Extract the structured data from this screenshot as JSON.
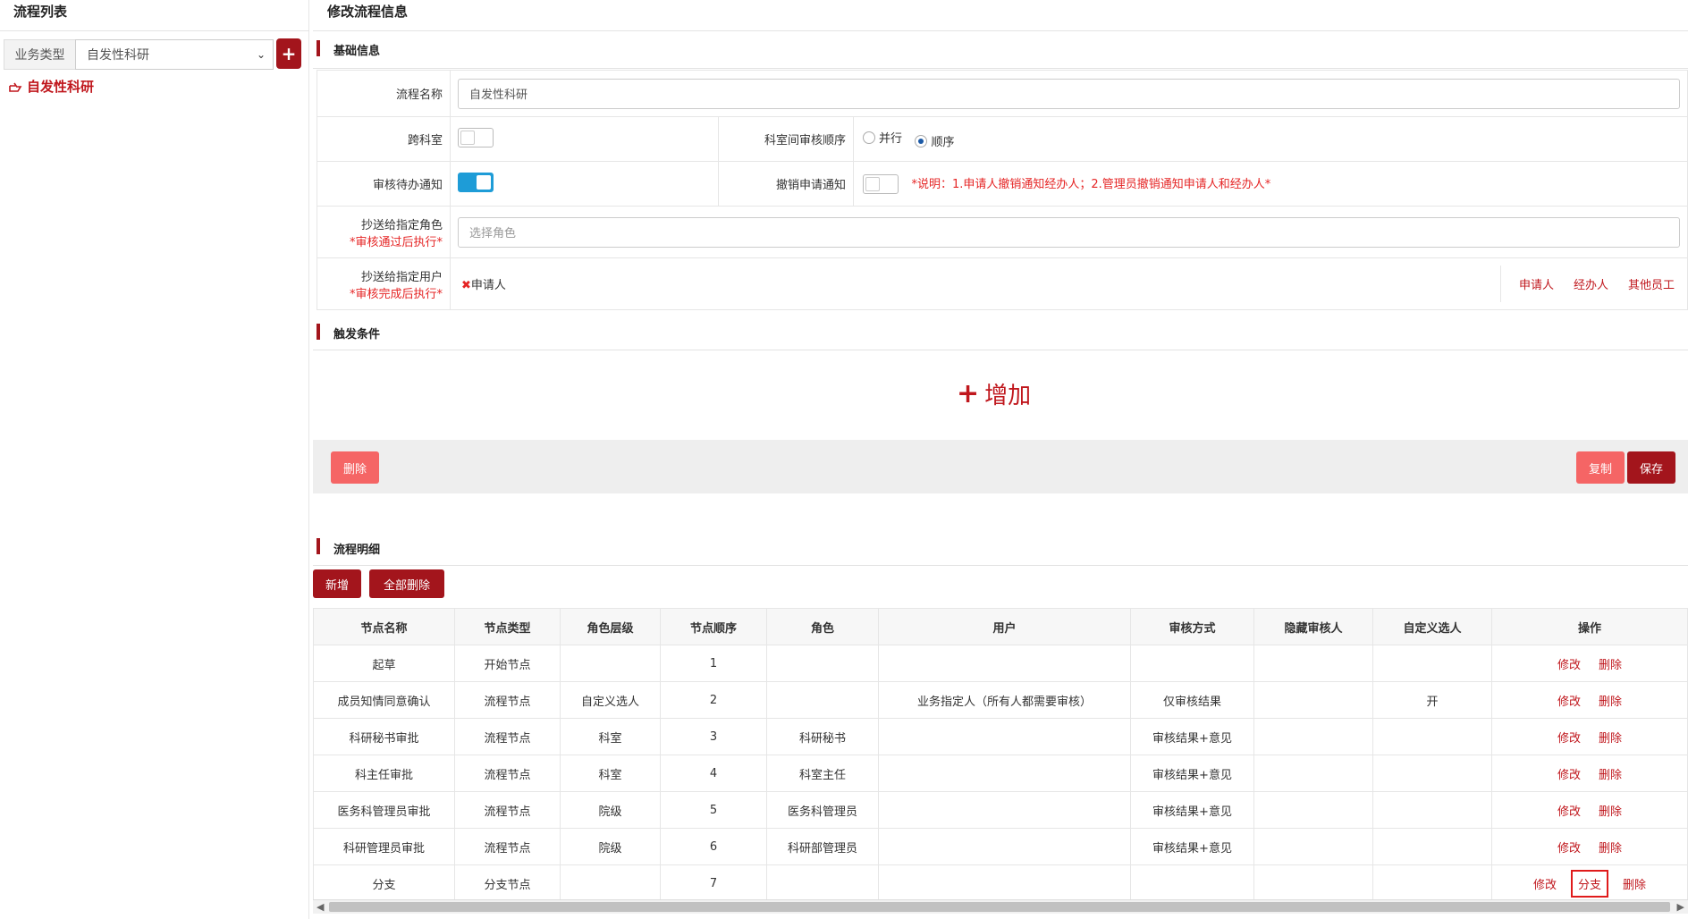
{
  "left": {
    "title": "流程列表",
    "type_label": "业务类型",
    "type_value": "自发性科研",
    "add_icon": "plus-icon",
    "tree_item": "自发性科研"
  },
  "right": {
    "title": "修改流程信息"
  },
  "basic": {
    "section_title": "基础信息",
    "name_label": "流程名称",
    "name_value": "自发性科研",
    "cross_label": "跨科室",
    "cross_on": false,
    "order_label": "科室间审核顺序",
    "order_options": [
      "并行",
      "顺序"
    ],
    "order_selected": "顺序",
    "notify_label": "审核待办通知",
    "notify_on": true,
    "revoke_label": "撤销申请通知",
    "revoke_on": false,
    "revoke_note": "*说明：1.申请人撤销通知经办人；2.管理员撤销通知申请人和经办人*",
    "role_label": "抄送给指定角色",
    "role_req": "*审核通过后执行*",
    "role_placeholder": "选择角色",
    "user_label": "抄送给指定用户",
    "user_req": "*审核完成后执行*",
    "user_tag": "申请人",
    "user_links": [
      "申请人",
      "经办人",
      "其他员工"
    ]
  },
  "trigger": {
    "section_title": "触发条件",
    "add_label": "增加"
  },
  "actions": {
    "delete": "删除",
    "copy": "复制",
    "save": "保存"
  },
  "detail": {
    "section_title": "流程明细",
    "new_btn": "新增",
    "delete_all_btn": "全部删除",
    "headers": [
      "节点名称",
      "节点类型",
      "角色层级",
      "节点顺序",
      "角色",
      "用户",
      "审核方式",
      "隐藏审核人",
      "自定义选人",
      "操作"
    ],
    "rows": [
      [
        "起草",
        "开始节点",
        "",
        "1",
        "",
        "",
        "",
        "",
        ""
      ],
      [
        "成员知情同意确认",
        "流程节点",
        "自定义选人",
        "2",
        "",
        "业务指定人（所有人都需要审核）",
        "仅审核结果",
        "",
        "开"
      ],
      [
        "科研秘书审批",
        "流程节点",
        "科室",
        "3",
        "科研秘书",
        "",
        "审核结果+意见",
        "",
        ""
      ],
      [
        "科主任审批",
        "流程节点",
        "科室",
        "4",
        "科室主任",
        "",
        "审核结果+意见",
        "",
        ""
      ],
      [
        "医务科管理员审批",
        "流程节点",
        "院级",
        "5",
        "医务科管理员",
        "",
        "审核结果+意见",
        "",
        ""
      ],
      [
        "科研管理员审批",
        "流程节点",
        "院级",
        "6",
        "科研部管理员",
        "",
        "审核结果+意见",
        "",
        ""
      ],
      [
        "分支",
        "分支节点",
        "",
        "7",
        "",
        "",
        "",
        "",
        ""
      ]
    ],
    "op_edit": "修改",
    "op_delete": "删除",
    "op_branch": "分支"
  },
  "colors": {
    "brand_dark": "#a3151c",
    "brand_red": "#c0171d",
    "salmon": "#f56565",
    "toggle_on": "#1e9cd7"
  }
}
